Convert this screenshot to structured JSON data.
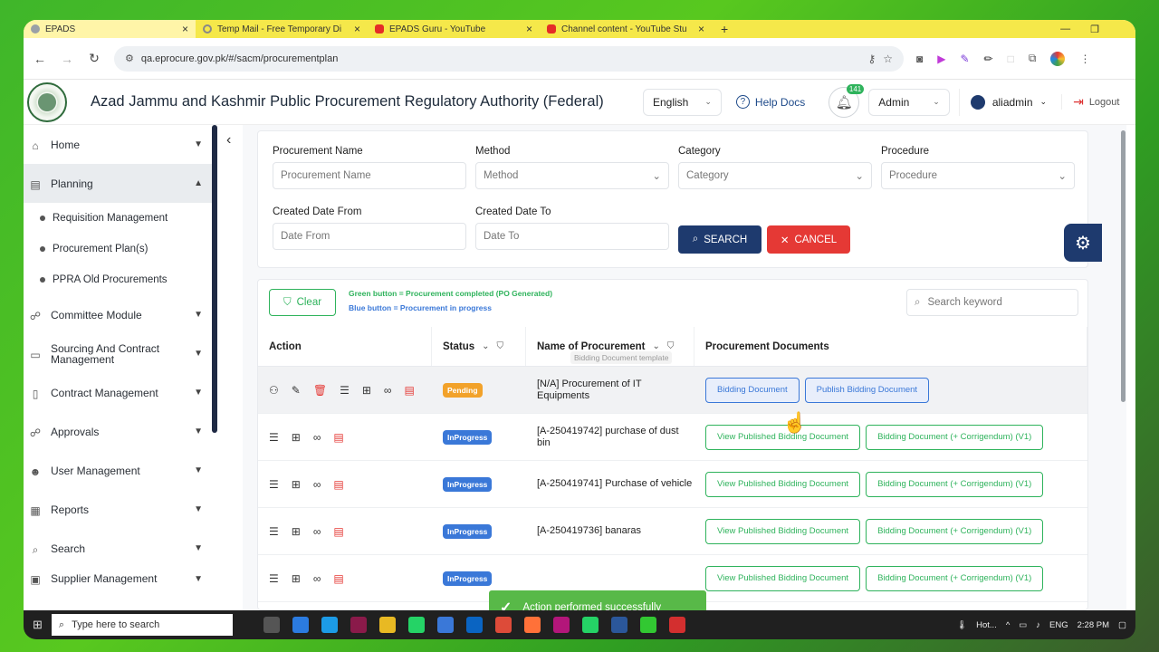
{
  "browser": {
    "tabs": [
      {
        "title": "EPADS"
      },
      {
        "title": "Temp Mail - Free Temporary Di"
      },
      {
        "title": "EPADS Guru - YouTube"
      },
      {
        "title": "Channel content - YouTube Stu"
      }
    ],
    "url": "qa.eprocure.gov.pk/#/sacm/procurementplan"
  },
  "header": {
    "title": "Azad Jammu and Kashmir Public Procurement Regulatory Authority (Federal)",
    "language": "English",
    "help_docs": "Help Docs",
    "notification_count": "141",
    "role": "Admin",
    "username": "aliadmin",
    "logout": "Logout"
  },
  "sidebar": {
    "items": [
      {
        "label": "Home"
      },
      {
        "label": "Planning"
      },
      {
        "label": "Committee Module"
      },
      {
        "label": "Sourcing And Contract Management"
      },
      {
        "label": "Contract Management"
      },
      {
        "label": "Approvals"
      },
      {
        "label": "User Management"
      },
      {
        "label": "Reports"
      },
      {
        "label": "Search"
      },
      {
        "label": "Supplier Management"
      }
    ],
    "planning_sub": [
      {
        "label": "Requisition Management"
      },
      {
        "label": "Procurement Plan(s)"
      },
      {
        "label": "PPRA Old Procurements"
      }
    ]
  },
  "filters": {
    "procurement_name": {
      "label": "Procurement Name",
      "placeholder": "Procurement Name"
    },
    "method": {
      "label": "Method",
      "placeholder": "Method"
    },
    "category": {
      "label": "Category",
      "placeholder": "Category"
    },
    "procedure": {
      "label": "Procedure",
      "placeholder": "Procedure"
    },
    "date_from": {
      "label": "Created Date From",
      "placeholder": "Date From"
    },
    "date_to": {
      "label": "Created Date To",
      "placeholder": "Date To"
    },
    "search_btn": "SEARCH",
    "cancel_btn": "CANCEL"
  },
  "table": {
    "clear_btn": "Clear",
    "legend_green": "Green button = Procurement completed (PO Generated)",
    "legend_blue": "Blue button = Procurement in progress",
    "search_placeholder": "Search keyword",
    "headers": {
      "action": "Action",
      "status": "Status",
      "name": "Name of Procurement",
      "docs": "Procurement Documents"
    },
    "rows": [
      {
        "status": "Pending",
        "name": "[N/A] Procurement of IT Equipments",
        "doc1": "Bidding Document",
        "doc2": "Publish Bidding Document"
      },
      {
        "status": "InProgress",
        "name": "[A-250419742] purchase of dust bin",
        "doc1": "View Published Bidding Document",
        "doc2": "Bidding Document (+ Corrigendum) (V1)"
      },
      {
        "status": "InProgress",
        "name": "[A-250419741] Purchase of vehicle",
        "doc1": "View Published Bidding Document",
        "doc2": "Bidding Document (+ Corrigendum) (V1)"
      },
      {
        "status": "InProgress",
        "name": "[A-250419736] banaras",
        "doc1": "View Published Bidding Document",
        "doc2": "Bidding Document (+ Corrigendum) (V1)"
      },
      {
        "status": "InProgress",
        "name": "",
        "doc1": "View Published Bidding Document",
        "doc2": "Bidding Document (+ Corrigendum) (V1)"
      }
    ]
  },
  "tooltip_ghost": "Bidding Document template",
  "toast": "Action performed successfully",
  "taskbar": {
    "search": "Type here to search",
    "weather": "Hot...",
    "lang": "ENG",
    "time": "2:28 PM"
  },
  "colors": {
    "primary": "#1e3a6e",
    "danger": "#e53935",
    "success": "#2fb35c",
    "info": "#3a78d8",
    "pending": "#f2a22a"
  }
}
